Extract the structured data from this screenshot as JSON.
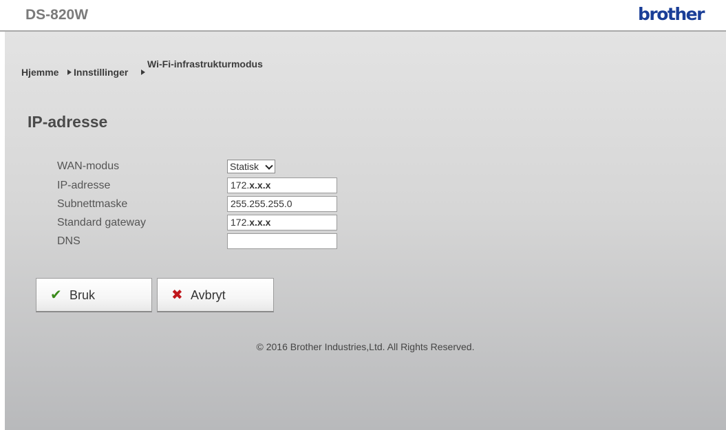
{
  "header": {
    "model": "DS-820W",
    "brand": "brother",
    "brand_color": "#1a3e97"
  },
  "breadcrumb": {
    "items": [
      "Hjemme",
      "Innstillinger",
      "Wi-Fi-infrastrukturmodus"
    ],
    "separator_icon": "triangle-right-icon"
  },
  "section": {
    "title": "IP-adresse"
  },
  "form": {
    "wan_mode": {
      "label": "WAN-modus",
      "value": "Statisk"
    },
    "ip_address": {
      "label": "IP-adresse",
      "value_prefix": "172.",
      "value_suffix": "x.x.x"
    },
    "subnet_mask": {
      "label": "Subnettmaske",
      "value": "255.255.255.0"
    },
    "gateway": {
      "label": "Standard gateway",
      "value_prefix": "172.",
      "value_suffix": "x.x.x"
    },
    "dns": {
      "label": "DNS",
      "value": ""
    }
  },
  "buttons": {
    "apply": {
      "label": "Bruk",
      "icon": "check-icon",
      "icon_color": "#3a8a1a"
    },
    "cancel": {
      "label": "Avbryt",
      "icon": "x-icon",
      "icon_color": "#c0171c"
    }
  },
  "footer": {
    "copyright": "© 2016 Brother Industries,Ltd. All Rights Reserved."
  }
}
